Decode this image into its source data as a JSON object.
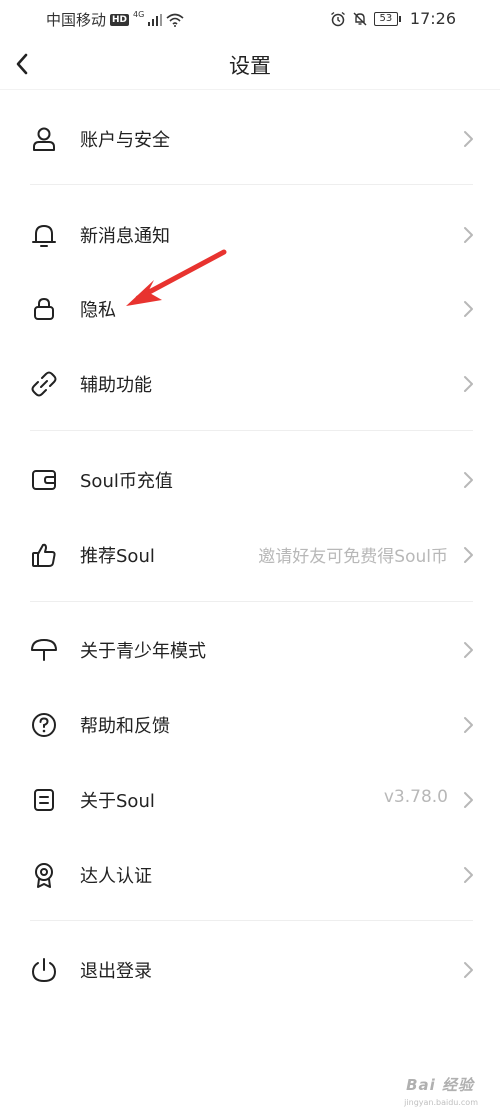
{
  "status_bar": {
    "carrier": "中国移动",
    "hd": "HD",
    "network": "4G",
    "battery": "53",
    "time": "17:26"
  },
  "nav": {
    "title": "设置"
  },
  "items": [
    {
      "label": "账户与安全",
      "value": "",
      "icon": "user-icon"
    },
    {
      "label": "新消息通知",
      "value": "",
      "icon": "bell-icon"
    },
    {
      "label": "隐私",
      "value": "",
      "icon": "lock-icon"
    },
    {
      "label": "辅助功能",
      "value": "",
      "icon": "link-icon"
    },
    {
      "label": "Soul币充值",
      "value": "",
      "icon": "wallet-icon"
    },
    {
      "label": "推荐Soul",
      "value": "邀请好友可免费得Soul币",
      "icon": "thumbs-up-icon"
    },
    {
      "label": "关于青少年模式",
      "value": "",
      "icon": "umbrella-icon"
    },
    {
      "label": "帮助和反馈",
      "value": "",
      "icon": "help-icon"
    },
    {
      "label": "关于Soul",
      "value": "v3.78.0",
      "icon": "document-icon"
    },
    {
      "label": "达人认证",
      "value": "",
      "icon": "badge-icon"
    },
    {
      "label": "退出登录",
      "value": "",
      "icon": "power-icon"
    }
  ],
  "colors": {
    "arrow": "#e8332f",
    "chevron": "#b8b8b8",
    "divider": "#eeeeee"
  },
  "watermark": {
    "brand": "Bai 经验",
    "url": "jingyan.baidu.com"
  }
}
